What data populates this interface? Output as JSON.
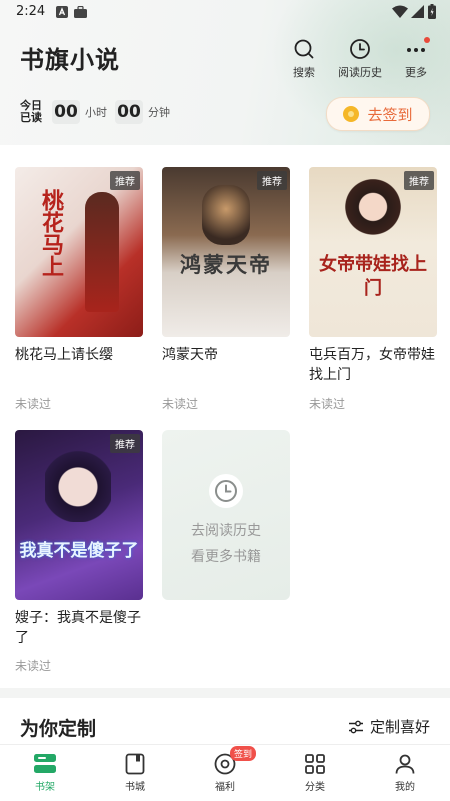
{
  "status": {
    "time": "2:24"
  },
  "header": {
    "title": "书旗小说",
    "actions": [
      {
        "label": "搜索",
        "icon": "search-icon"
      },
      {
        "label": "阅读历史",
        "icon": "clock-icon"
      },
      {
        "label": "更多",
        "icon": "more-icon",
        "has_dot": true
      }
    ]
  },
  "reading_time": {
    "label_line1": "今日",
    "label_line2": "已读",
    "hours": "00",
    "hours_unit": "小时",
    "minutes": "00",
    "minutes_unit": "分钟"
  },
  "signin": {
    "label": "去签到"
  },
  "books": [
    {
      "title": "桃花马上请长缨",
      "status": "未读过",
      "badge": "推荐",
      "cover_text": "桃花马上",
      "cover_colors": [
        "#f3e9e4",
        "#b82c25"
      ]
    },
    {
      "title": "鸿蒙天帝",
      "status": "未读过",
      "badge": "推荐",
      "cover_text": "鸿蒙天帝",
      "cover_colors": [
        "#6a5a4c",
        "#ece7e2"
      ]
    },
    {
      "title": "屯兵百万，女帝带娃找上门",
      "status": "未读过",
      "badge": "推荐",
      "cover_text": "女帝带娃找上门",
      "cover_colors": [
        "#efe3cf",
        "#d9c6a6"
      ]
    },
    {
      "title": "嫂子：我真不是傻子了",
      "status": "未读过",
      "badge": "推荐",
      "cover_text": "我真不是傻子了",
      "cover_colors": [
        "#2d1b4a",
        "#6d3fa8"
      ]
    }
  ],
  "history_card": {
    "line1": "去阅读历史",
    "line2": "看更多书籍"
  },
  "recommend": {
    "title": "为你定制",
    "pref_label": "定制喜好"
  },
  "tabs": [
    {
      "label": "书架",
      "icon": "bookshelf-icon",
      "active": true
    },
    {
      "label": "书城",
      "icon": "bookstore-icon",
      "active": false
    },
    {
      "label": "福利",
      "icon": "welfare-icon",
      "active": false,
      "badge": "签到"
    },
    {
      "label": "分类",
      "icon": "category-icon",
      "active": false
    },
    {
      "label": "我的",
      "icon": "profile-icon",
      "active": false
    }
  ],
  "colors": {
    "accent": "#23a866",
    "signin_text": "#e86a3a",
    "badge_red": "#f0504a"
  }
}
